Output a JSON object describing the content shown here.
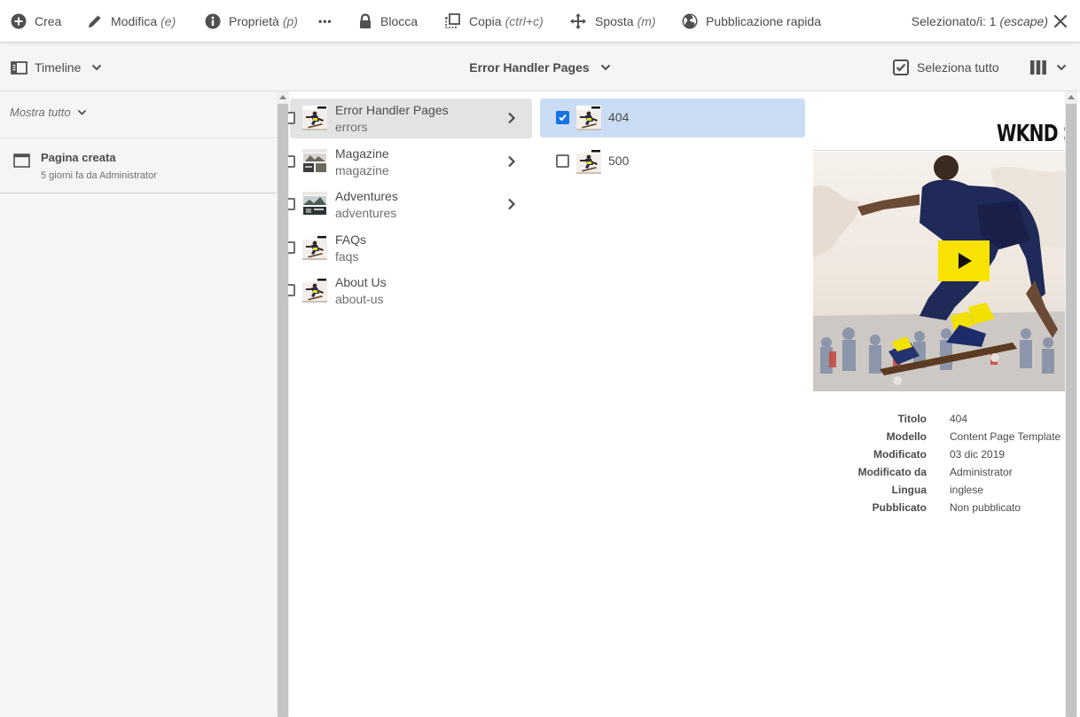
{
  "actionbar": {
    "create": "Crea",
    "edit": "Modifica",
    "edit_shortcut": "(e)",
    "properties": "Proprietà",
    "properties_shortcut": "(p)",
    "more": "•••",
    "lock": "Blocca",
    "copy": "Copia",
    "copy_shortcut": "(ctrl+c)",
    "move": "Sposta",
    "move_shortcut": "(m)",
    "quick_publish": "Pubblicazione rapida",
    "selection": "Selezionato/i: 1",
    "selection_shortcut": "(escape)"
  },
  "titlebar": {
    "rail_label": "Timeline",
    "title": "Error Handler Pages",
    "select_all": "Seleziona tutto"
  },
  "rail": {
    "filter": "Mostra tutto",
    "item_title": "Pagina creata",
    "item_sub": "5 giorni fa da Administrator"
  },
  "column1": [
    {
      "title": "Error Handler Pages",
      "name": "errors"
    },
    {
      "title": "Magazine",
      "name": "magazine"
    },
    {
      "title": "Adventures",
      "name": "adventures"
    },
    {
      "title": "FAQs",
      "name": "faqs"
    },
    {
      "title": "About Us",
      "name": "about-us"
    }
  ],
  "column2": [
    {
      "label": "404",
      "selected": true
    },
    {
      "label": "500",
      "selected": false
    }
  ],
  "preview": {
    "brand": "WKND S",
    "fields": [
      {
        "k": "Titolo",
        "v": "404"
      },
      {
        "k": "Modello",
        "v": "Content Page Template"
      },
      {
        "k": "Modificato",
        "v": "03 dic 2019"
      },
      {
        "k": "Modificato da",
        "v": "Administrator"
      },
      {
        "k": "Lingua",
        "v": "inglese"
      },
      {
        "k": "Pubblicato",
        "v": "Non pubblicato"
      }
    ]
  },
  "colors": {
    "accent": "#1473e6",
    "selection": "#cbddf5",
    "play": "#f7e200"
  }
}
